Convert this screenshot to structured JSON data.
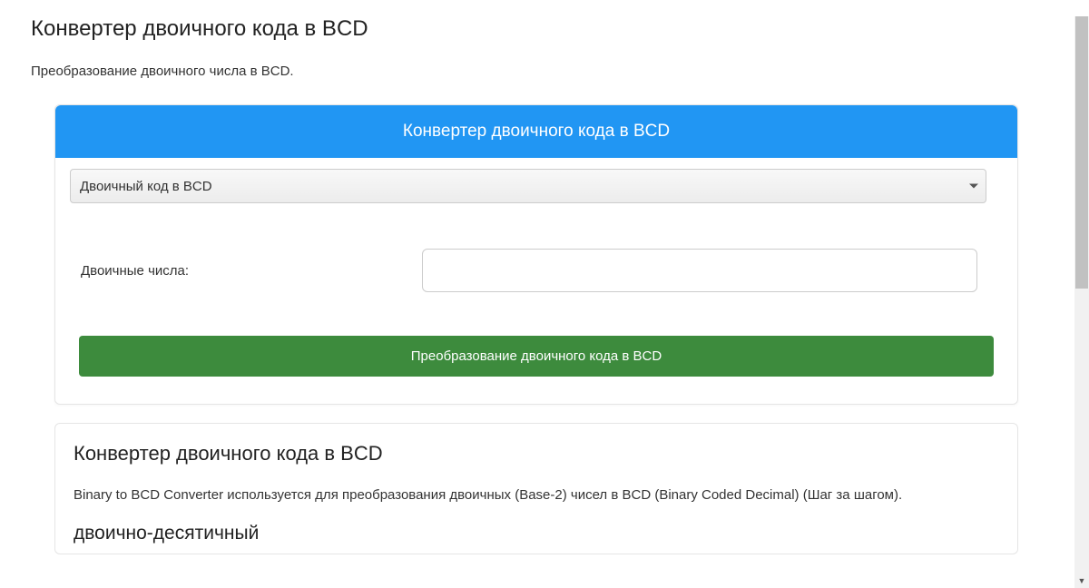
{
  "page": {
    "title": "Конвертер двоичного кода в BCD",
    "subtitle": "Преобразование двоичного числа в BCD."
  },
  "panel": {
    "header": "Конвертер двоичного кода в BCD",
    "select_value": "Двоичный код в BCD",
    "input_label": "Двоичные числа:",
    "input_value": "",
    "button_label": "Преобразование двоичного кода в BCD"
  },
  "info": {
    "heading": "Конвертер двоичного кода в BCD",
    "description": "Binary to BCD Converter используется для преобразования двоичных (Base-2) чисел в BCD (Binary Coded Decimal) (Шаг за шагом).",
    "subheading": "двоично-десятичный"
  }
}
